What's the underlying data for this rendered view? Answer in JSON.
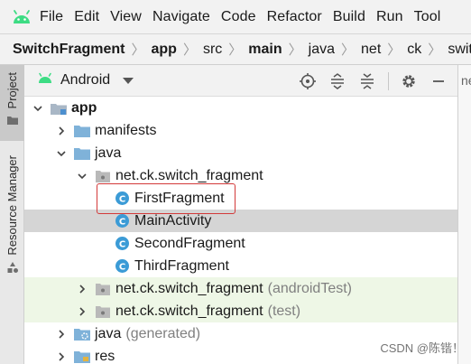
{
  "menubar": {
    "items": [
      "File",
      "Edit",
      "View",
      "Navigate",
      "Code",
      "Refactor",
      "Build",
      "Run",
      "Tool"
    ]
  },
  "breadcrumb": {
    "items": [
      "SwitchFragment",
      "app",
      "src",
      "main",
      "java",
      "net",
      "ck",
      "switch_frag"
    ]
  },
  "toolwindows": {
    "project": "Project",
    "resource_manager": "Resource Manager",
    "right_tab": "ne"
  },
  "panel": {
    "view_mode": "Android"
  },
  "tree": {
    "app": "app",
    "manifests": "manifests",
    "java": "java",
    "package_main": "net.ck.switch_fragment",
    "first_fragment": "FirstFragment",
    "main_activity": "MainActivity",
    "second_fragment": "SecondFragment",
    "third_fragment": "ThirdFragment",
    "package_android_test": "net.ck.switch_fragment",
    "android_test_suffix": "(androidTest)",
    "package_test": "net.ck.switch_fragment",
    "test_suffix": "(test)",
    "java_generated": "java",
    "generated_suffix": "(generated)",
    "res": "res"
  },
  "watermark": "CSDN @陈锴！",
  "colors": {
    "android_green": "#3ddc84",
    "folder_blue": "#7fb2d9",
    "class_circle": "#3b9bd6",
    "selection": "#d5d5d5",
    "test_bg": "#eef7e6",
    "highlight_border": "#d33a3a"
  }
}
